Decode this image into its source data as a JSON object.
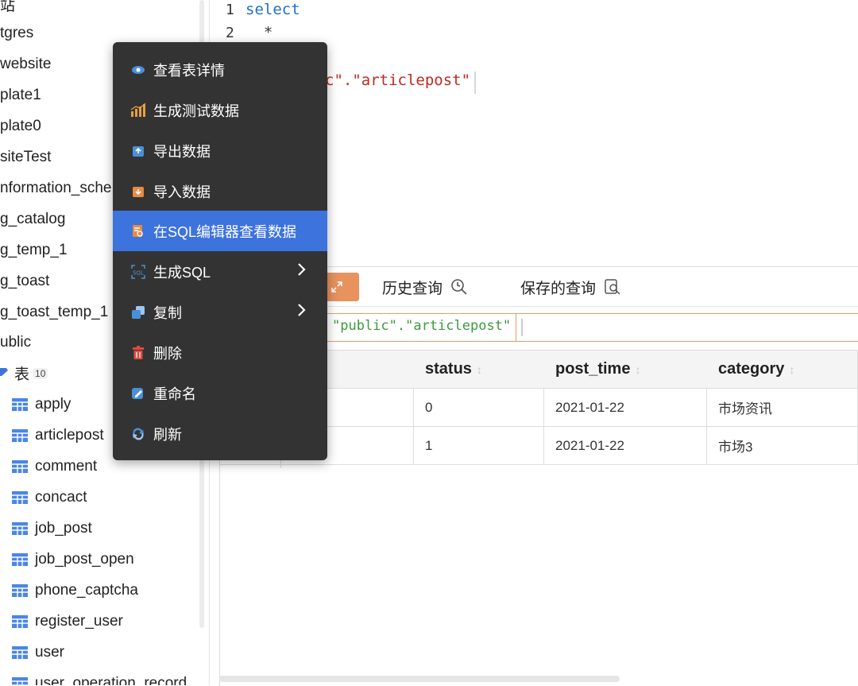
{
  "sidebar": {
    "rows": [
      {
        "label": "站"
      },
      {
        "label": "tgres"
      },
      {
        "label": "website"
      },
      {
        "label": "plate1"
      },
      {
        "label": "plate0"
      },
      {
        "label": "siteTest"
      },
      {
        "label": "nformation_sche"
      },
      {
        "label": "g_catalog"
      },
      {
        "label": "g_temp_1"
      },
      {
        "label": "g_toast"
      },
      {
        "label": "g_toast_temp_1"
      },
      {
        "label": "ublic"
      }
    ],
    "folder": {
      "label": "表",
      "count": "10"
    },
    "tables": [
      {
        "label": "apply"
      },
      {
        "label": "articlepost"
      },
      {
        "label": "comment"
      },
      {
        "label": "concact"
      },
      {
        "label": "job_post"
      },
      {
        "label": "job_post_open"
      },
      {
        "label": "phone_captcha"
      },
      {
        "label": "register_user"
      },
      {
        "label": "user"
      },
      {
        "label": "user_operation_record"
      }
    ]
  },
  "editor": {
    "lines": [
      {
        "num": "1",
        "text": "select"
      },
      {
        "num": "2",
        "text": "  *"
      }
    ],
    "line3_text": "c\".\"articlepost\""
  },
  "results": {
    "tabs": [
      {
        "label": "历史查询"
      },
      {
        "label": "保存的查询"
      }
    ],
    "query_text": "\"public\".\"articlepost\"",
    "columns": [
      {
        "label": "status"
      },
      {
        "label": "post_time"
      },
      {
        "label": "category"
      }
    ],
    "rows": [
      {
        "status": "0",
        "post_time": "2021-01-22",
        "category": "市场资讯"
      },
      {
        "status": "1",
        "post_time": "2021-01-22",
        "category": "市场3"
      }
    ]
  },
  "context_menu": {
    "items": [
      {
        "label": "查看表详情",
        "icon": "eye-icon"
      },
      {
        "label": "生成测试数据",
        "icon": "bar-chart-icon"
      },
      {
        "label": "导出数据",
        "icon": "export-icon"
      },
      {
        "label": "导入数据",
        "icon": "import-icon"
      },
      {
        "label": "在SQL编辑器查看数据",
        "icon": "sql-editor-icon"
      },
      {
        "label": "生成SQL",
        "icon": "sql-icon"
      },
      {
        "label": "复制",
        "icon": "copy-icon"
      },
      {
        "label": "删除",
        "icon": "trash-icon"
      },
      {
        "label": "重命名",
        "icon": "rename-icon"
      },
      {
        "label": "刷新",
        "icon": "refresh-icon"
      }
    ]
  },
  "colors": {
    "menu_bg": "#333333",
    "menu_active": "#3d73dd",
    "accent_orange": "#e8925e",
    "keyword_blue": "#1f6fd1",
    "string_red": "#c1291e",
    "query_green": "#3d9a3d"
  }
}
